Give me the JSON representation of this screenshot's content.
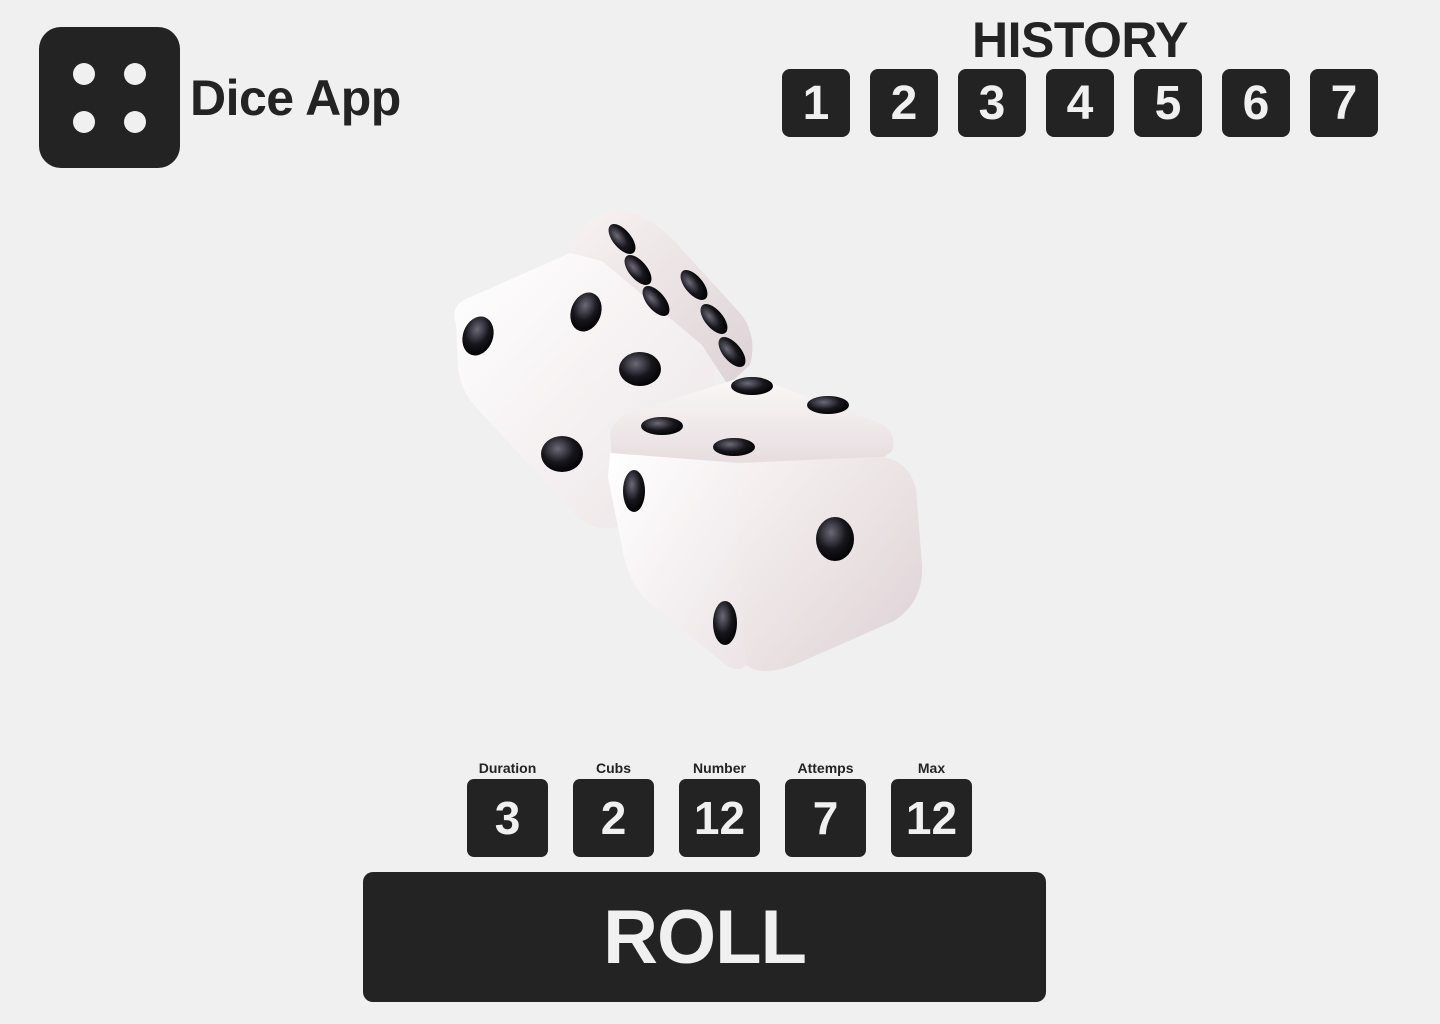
{
  "app": {
    "title": "Dice App",
    "logo_icon": "dice-four-icon"
  },
  "history": {
    "title": "HISTORY",
    "items": [
      "1",
      "2",
      "3",
      "4",
      "5",
      "6",
      "7"
    ]
  },
  "illustration": {
    "icon": "two-dice-icon"
  },
  "stats": [
    {
      "label": "Duration",
      "value": "3"
    },
    {
      "label": "Cubs",
      "value": "2"
    },
    {
      "label": "Number",
      "value": "12"
    },
    {
      "label": "Attemps",
      "value": "7"
    },
    {
      "label": "Max",
      "value": "12"
    }
  ],
  "roll_button": {
    "label": "ROLL"
  },
  "colors": {
    "background": "#f0f0f0",
    "tile": "#232323",
    "tile_text": "#f0f0f0"
  }
}
